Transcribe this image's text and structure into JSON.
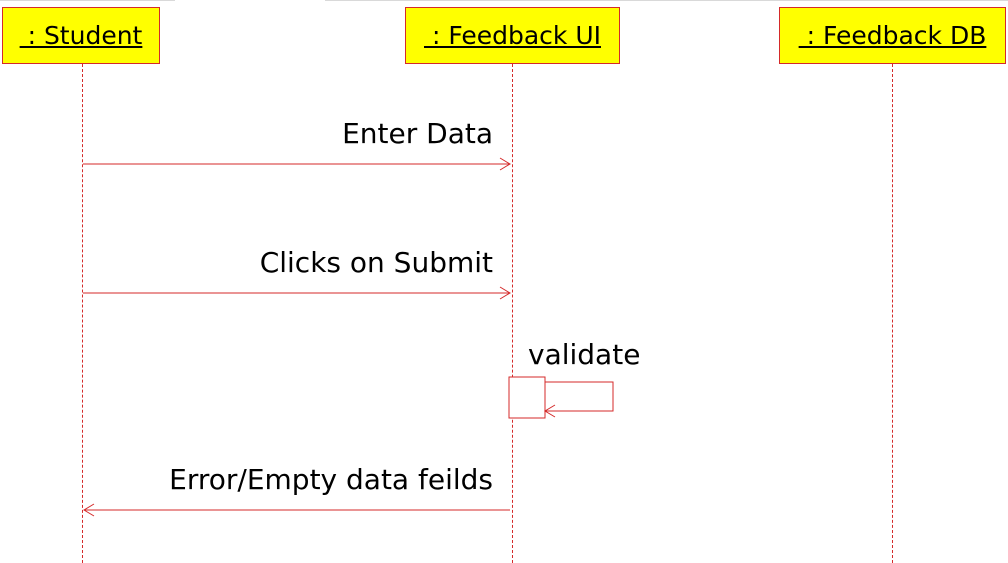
{
  "colors": {
    "line": "#d42a2a",
    "actor_fill": "#ffff00",
    "text": "#000000"
  },
  "actors": [
    {
      "label": " : Student"
    },
    {
      "label": " : Feedback UI"
    },
    {
      "label": " : Feedback DB"
    }
  ],
  "messages": [
    {
      "label": "Enter Data",
      "from": 0,
      "to": 1,
      "kind": "sync"
    },
    {
      "label": "Clicks on Submit",
      "from": 0,
      "to": 1,
      "kind": "sync"
    },
    {
      "label": "validate",
      "from": 1,
      "to": 1,
      "kind": "self"
    },
    {
      "label": "Error/Empty data feilds",
      "from": 1,
      "to": 0,
      "kind": "return"
    }
  ]
}
